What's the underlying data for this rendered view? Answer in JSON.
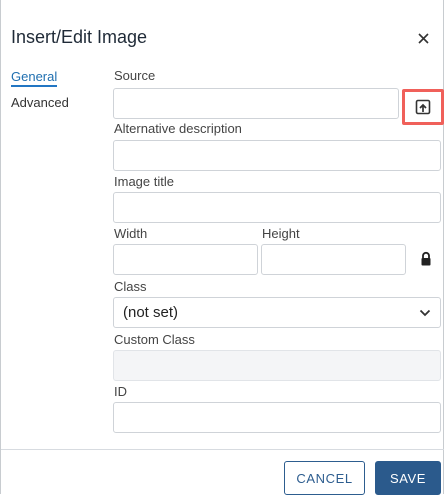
{
  "dialog": {
    "title": "Insert/Edit Image",
    "close_icon": "close-icon"
  },
  "tabs": [
    {
      "label": "General",
      "active": true
    },
    {
      "label": "Advanced",
      "active": false
    }
  ],
  "form": {
    "source_label": "Source",
    "source_value": "",
    "upload_icon": "upload-icon",
    "alt_label": "Alternative description",
    "alt_value": "",
    "title_label": "Image title",
    "title_value": "",
    "width_label": "Width",
    "width_value": "",
    "height_label": "Height",
    "height_value": "",
    "lock_icon": "lock-icon",
    "class_label": "Class",
    "class_value": "(not set)",
    "custom_class_label": "Custom Class",
    "custom_class_value": "",
    "id_label": "ID",
    "id_value": ""
  },
  "footer": {
    "cancel_label": "CANCEL",
    "save_label": "SAVE"
  },
  "colors": {
    "accent": "#2b5a8c",
    "highlight": "#f0605a",
    "active_tab": "#2276c3"
  }
}
